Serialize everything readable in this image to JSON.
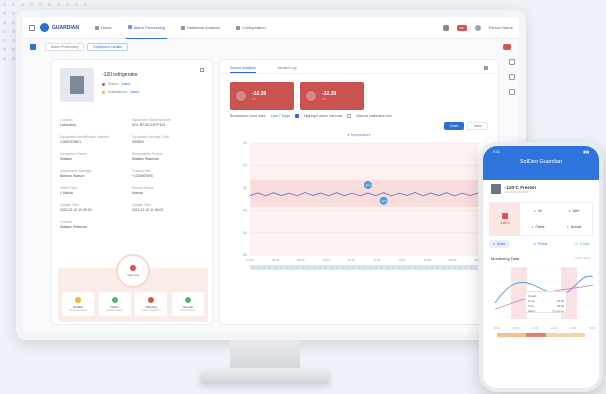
{
  "topbar": {
    "app_name": "GUARDIAN",
    "nav": [
      "Home",
      "Alarm Processing",
      "Statistical Analysis",
      "Configuration"
    ],
    "alert_count": "99+",
    "user": "Person Name"
  },
  "subbar": {
    "tabs": [
      "Alarm Processing",
      "Equipment Details"
    ]
  },
  "device": {
    "name": "-120 refrigerator",
    "status_label": "Status:",
    "status_value": "Alarm",
    "sub_label": "Notifications:",
    "sub_value": "Alarm"
  },
  "info": [
    {
      "label": "Location",
      "value": "Laboratory"
    },
    {
      "label": "Equipment Serial Number",
      "value": "SDL-RF1013-BTP103"
    },
    {
      "label": "Equipment Identification Number",
      "value": "C0BE0C0B01"
    },
    {
      "label": "Equipment Identity Code",
      "value": "S00B00"
    },
    {
      "label": "Equipment Owner",
      "value": "Wallace"
    },
    {
      "label": "Responsible Person",
      "value": "Wallace Wiseman"
    },
    {
      "label": "Department Manager",
      "value": "Barbara Watson"
    },
    {
      "label": "Contact Info",
      "value": "+1234567890"
    },
    {
      "label": "Alarm Time",
      "value": "1 Minute"
    },
    {
      "label": "Sensor Status",
      "value": "Normal"
    },
    {
      "label": "Update Time",
      "value": "2023-02-20 10:39:05"
    },
    {
      "label": "Update Time",
      "value": "2023-12-02 11:36:00"
    },
    {
      "label": "Contact",
      "value": "Wallace Wiseman"
    }
  ],
  "alarm": {
    "center_label": "Alarming",
    "actions": [
      {
        "label": "Disable",
        "sub": "Assigned alarm",
        "color": "#f0b34a"
      },
      {
        "label": "Online",
        "sub": "No fault alarm",
        "color": "#4cb86b"
      },
      {
        "label": "Warning",
        "sub": "Alarm Triggered",
        "color": "#d9534f"
      },
      {
        "label": "Normal",
        "sub": "Active Status",
        "color": "#4cb86b"
      }
    ]
  },
  "detail": {
    "tabs": [
      "Sensor Analysis",
      "Monitor Log"
    ],
    "tiles": [
      {
        "value": "-32.39",
        "unit": "°C"
      },
      {
        "value": "-32.39",
        "unit": "°C"
      }
    ],
    "opt1_label": "Breakdown chart data:",
    "opt1_value": "Last 7 Days",
    "opt2_label": "Highlight alarm intervals",
    "opt3_label": "Manual calibration line",
    "view_tabs": [
      "Chart",
      "Table"
    ],
    "legend": "Temperature"
  },
  "chart_data": {
    "type": "line",
    "series": [
      {
        "name": "Temperature",
        "values": [
          -33.5,
          -32.3,
          -33.6,
          -32.2,
          -33.5,
          -32.4,
          -33.6,
          -32.1,
          -33.4,
          -32.3,
          -33.6,
          -32.2,
          -33.5,
          -32.4,
          -33.6,
          -32.3,
          -33.5,
          -32.2,
          -33.6,
          -32.4,
          -33.4,
          -32.1,
          -33.6,
          -32.3,
          -33.5,
          -32.2,
          -33.6,
          -32.4,
          -33.5,
          -32.3
        ]
      }
    ],
    "ylim": [
      -60,
      -10
    ],
    "yticks": [
      "-10",
      "-20",
      "-30",
      "-40",
      "-50",
      "-60"
    ],
    "xticks": [
      "07:00",
      "08:00",
      "09:00",
      "10:00",
      "11:00",
      "12:00",
      "13:00",
      "14:00",
      "15:00",
      "16:00"
    ],
    "marker_labels": [
      "-32.4",
      "-32.6"
    ],
    "alarm_band": [
      -35,
      -30
    ],
    "colors": {
      "line": "#6b69c7",
      "alarm": "#f6cfcf",
      "marker": "#4e9be0"
    }
  },
  "phone": {
    "time": "9:41",
    "title": "SolDeo Guardian",
    "device_name": "-120°C Freezer",
    "device_sub": "2023-02-20 09:09",
    "alarm_label": "Alarm",
    "options": [
      {
        "label": "On",
        "color": "#4cb86b"
      },
      {
        "label": "Alert",
        "color": "#d9534f"
      },
      {
        "label": "Online",
        "color": "#4cb86b"
      },
      {
        "label": "Normal",
        "color": "#4cb86b"
      }
    ],
    "contacts": [
      "Notes",
      "Phone",
      "E-Mail"
    ],
    "monitor_title": "Monitoring Data",
    "monitor_range": "Last 7 Days",
    "card": {
      "head": "Details",
      "rows": [
        {
          "k": "Temp",
          "v": "-32.39"
        },
        {
          "k": "Time",
          "v": "09:09"
        },
        {
          "k": "Alarm",
          "v": "Triggered"
        }
      ]
    },
    "xticks": [
      "06:00",
      "08:00",
      "10:00",
      "12:00",
      "14:00",
      "16:00"
    ]
  }
}
